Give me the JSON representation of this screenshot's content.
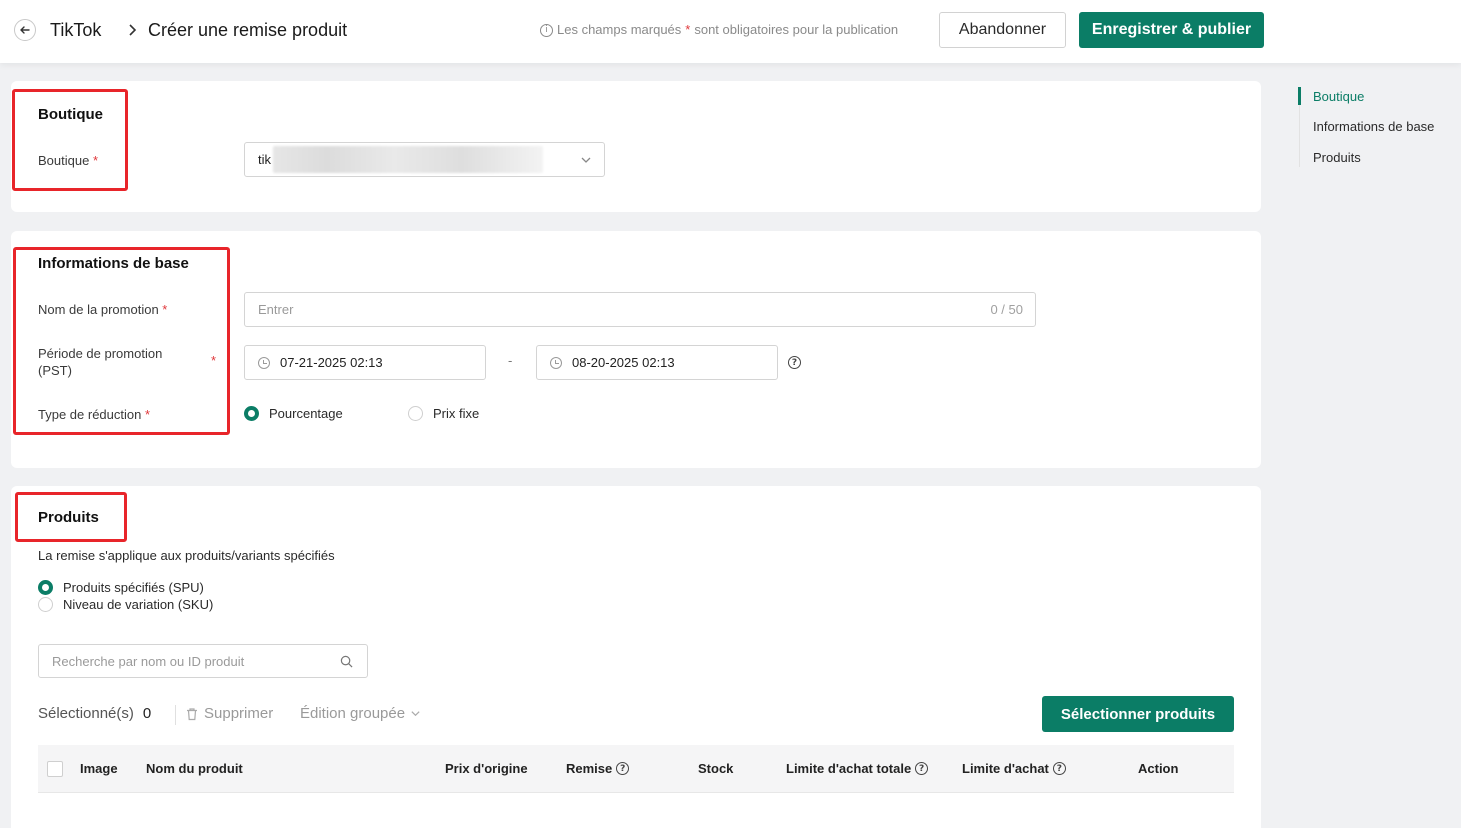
{
  "header": {
    "breadcrumb_root": "TikTok",
    "breadcrumb_current": "Créer une remise produit",
    "notice_before": "Les champs marqués",
    "notice_star": "*",
    "notice_after": "sont obligatoires pour la publication",
    "abandon_label": "Abandonner",
    "publish_label": "Enregistrer & publier"
  },
  "boutique": {
    "title": "Boutique",
    "field_label": "Boutique",
    "required": "*",
    "value_visible": "tik"
  },
  "base": {
    "title": "Informations de base",
    "name_label": "Nom de la promotion",
    "name_placeholder": "Entrer",
    "name_counter": "0 / 50",
    "period_label": "Période de promotion (PST)",
    "period_start": "07-21-2025 02:13",
    "period_end": "08-20-2025 02:13",
    "period_separator": "-",
    "type_label": "Type de réduction",
    "type_options": [
      "Pourcentage",
      "Prix fixe"
    ],
    "type_selected": "Pourcentage",
    "required": "*"
  },
  "produits": {
    "title": "Produits",
    "description": "La remise s'applique aux produits/variants spécifiés",
    "scope_options": [
      "Produits spécifiés (SPU)",
      "Niveau de variation (SKU)"
    ],
    "scope_selected": "Produits spécifiés (SPU)",
    "search_placeholder": "Recherche par nom ou ID produit",
    "selected_label": "Sélectionné(s)",
    "selected_count": "0",
    "delete_label": "Supprimer",
    "bulk_edit_label": "Édition groupée",
    "select_products_label": "Sélectionner produits",
    "columns": [
      "Image",
      "Nom du produit",
      "Prix d'origine",
      "Remise",
      "Stock",
      "Limite d'achat totale",
      "Limite d'achat",
      "Action"
    ]
  },
  "anchor_nav": {
    "items": [
      "Boutique",
      "Informations de base",
      "Produits"
    ],
    "active": "Boutique"
  },
  "colors": {
    "primary": "#0b7d66",
    "required_star": "#e0373a",
    "highlight_box": "#e8252a"
  }
}
